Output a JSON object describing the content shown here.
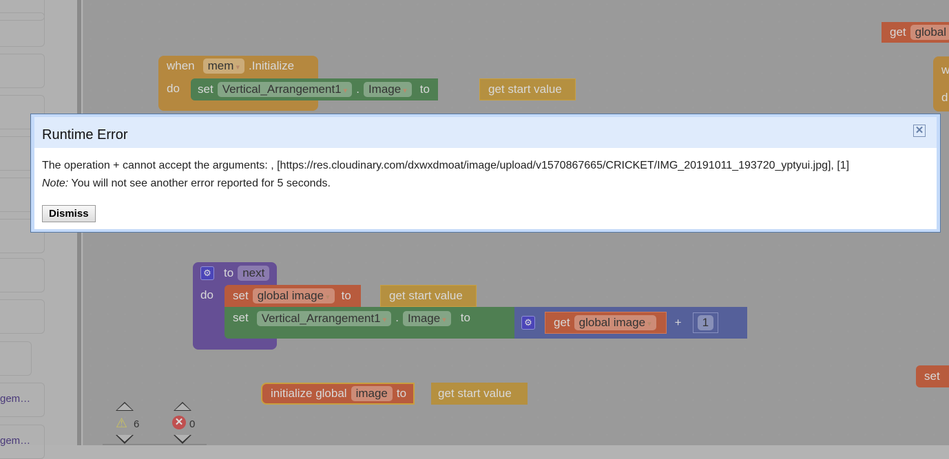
{
  "sidebar": {
    "items": [
      {
        "label": ""
      },
      {
        "label": ""
      },
      {
        "label": ""
      },
      {
        "label": ""
      },
      {
        "label": ""
      },
      {
        "label": ""
      },
      {
        "label": ""
      },
      {
        "label": ""
      },
      {
        "label": ""
      },
      {
        "label": "gem…"
      },
      {
        "label": "gem…"
      }
    ]
  },
  "blocks": {
    "init_event": {
      "when": "when",
      "component": "mem",
      "event": ".Initialize",
      "do": "do",
      "set": "set",
      "target": "Vertical_Arrangement1",
      "dot": ".",
      "property": "Image",
      "to": "to",
      "value": "get start value"
    },
    "top_right_get": {
      "get": "get",
      "var": "global"
    },
    "right_event": {
      "w": "w",
      "d": "d"
    },
    "procedure": {
      "to": "to",
      "name": "next",
      "do": "do",
      "set1": {
        "set": "set",
        "var": "global image",
        "to": "to",
        "value": "get start value"
      },
      "set2": {
        "set": "set",
        "target": "Vertical_Arrangement1",
        "dot": ".",
        "property": "Image",
        "to": "to",
        "get": "get",
        "var": "global image",
        "op": "+",
        "num": "1"
      }
    },
    "init_global": {
      "label": "initialize global",
      "name": "image",
      "to": "to",
      "value": "get start value"
    },
    "right_set": {
      "set": "set"
    }
  },
  "indicators": {
    "warnings": "6",
    "errors": "0"
  },
  "dialog": {
    "title": "Runtime Error",
    "message": "The operation + cannot accept the arguments: , [https://res.cloudinary.com/dxwxdmoat/image/upload/v1570867665/CRICKET/IMG_20191011_193720_yptyui.jpg], [1]",
    "note_label": "Note:",
    "note": " You will not see another error reported for 5 seconds.",
    "dismiss": "Dismiss",
    "close": "✕"
  }
}
